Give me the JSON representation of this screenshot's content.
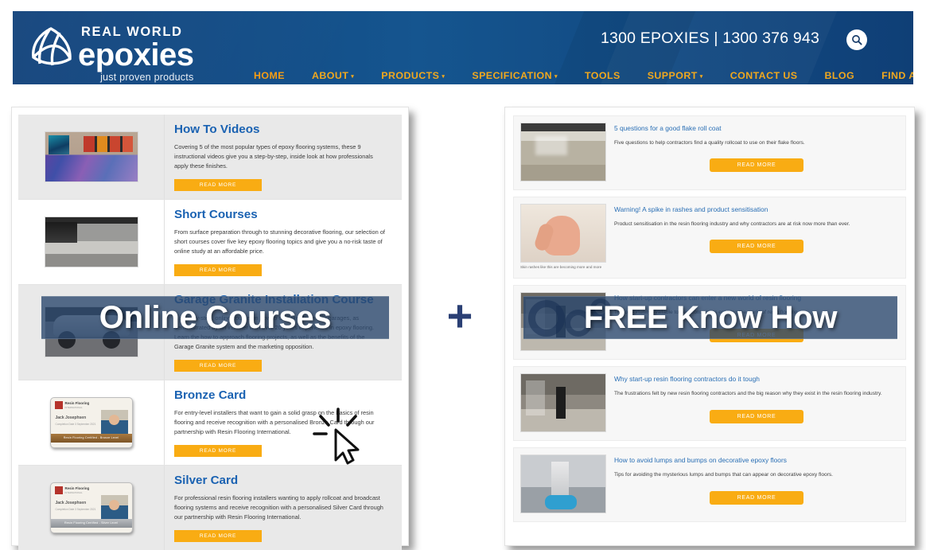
{
  "header": {
    "logo": {
      "line1": "REAL WORLD",
      "line2": "epoxies",
      "tagline": "just proven products",
      "mark": "epoxies-globe-logo"
    },
    "phone": "1300 EPOXIES | 1300 376 943",
    "search_icon": "search-icon",
    "nav": [
      {
        "label": "HOME",
        "caret": "",
        "active": true
      },
      {
        "label": "ABOUT",
        "caret": "▾",
        "active": false
      },
      {
        "label": "PRODUCTS",
        "caret": "▾",
        "active": false
      },
      {
        "label": "SPECIFICATION",
        "caret": "▾",
        "active": false
      },
      {
        "label": "TOOLS",
        "caret": "",
        "active": false
      },
      {
        "label": "SUPPORT",
        "caret": "▾",
        "active": false
      },
      {
        "label": "CONTACT US",
        "caret": "",
        "active": false
      },
      {
        "label": "BLOG",
        "caret": "",
        "active": false
      },
      {
        "label": "FIND AN INSTALLER",
        "caret": "",
        "active": false
      }
    ],
    "colors": {
      "bar": "#12457f",
      "nav_link": "#f0a81e"
    }
  },
  "overlays": {
    "left_banner": "Online Courses",
    "right_banner": "FREE Know How",
    "plus": "+",
    "cursor_icon": "click-cursor-icon"
  },
  "left_panel": {
    "name": "online-courses-panel",
    "rows": [
      {
        "title": "How To Videos",
        "desc": "Covering 5 of the most popular types of epoxy flooring systems, these 9 instructional videos give you a step-by-step, inside look at how professionals apply these finishes.",
        "button": "READ MORE",
        "thumb": "gallery-floor-photo"
      },
      {
        "title": "Short Courses",
        "desc": "From surface preparation through to stunning decorative flooring, our selection of short courses cover five key epoxy flooring topics and give you a no-risk taste of online study at an affordable price.",
        "button": "READ MORE",
        "thumb": "warehouse-floor-photo"
      },
      {
        "title": "Garage Granite Installation Course",
        "desc": "A step-by-step, online course on how to do flake flooring in garages, as demonstrated by an installer with over 20 years experience in epoxy flooring. Learn the how to approach flooring projects, as well as the benefits of the Garage Granite system and the marketing opposition.",
        "button": "READ MORE",
        "thumb": "garage-car-photo"
      },
      {
        "title": "Bronze Card",
        "desc": "For entry-level installers that want to gain a solid grasp on the basics of resin flooring and receive recognition with a personalised Bronze Card through our partnership with Resin Flooring International.",
        "button": "READ MORE",
        "thumb": "bronze-id-card"
      },
      {
        "title": "Silver Card",
        "desc": "For professional resin flooring installers wanting to apply rollcoat and broadcast flooring systems and receive recognition with a personalised Silver Card through our partnership with Resin Flooring International.",
        "button": "READ MORE",
        "thumb": "silver-id-card"
      }
    ],
    "id_card": {
      "brand": "Resin Flooring",
      "brand_sub": "INTERNATIONAL",
      "name": "Jack Josephsen",
      "meta": "Completion Date\n3 September 2021",
      "bronze_band": "Resin Flooring Certified - Bronze Level",
      "silver_band": "Resin Flooring Certified - Silver Level"
    }
  },
  "right_panel": {
    "name": "free-know-how-panel",
    "rows": [
      {
        "title": "5 questions for a good flake roll coat",
        "desc": "Five questions to help contractors find a quality rollcoat to use on their flake floors.",
        "button": "READ MORE",
        "thumb": "wet-flake-floor-photo",
        "caption": ""
      },
      {
        "title": "Warning! A spike in rashes and product sensitisation",
        "desc": "Product sensitisation in the resin flooring industry and why contractors are at risk now more than ever.",
        "button": "READ MORE",
        "thumb": "skin-rash-hand-photo",
        "caption": "Skin rashes like this are becoming more and more"
      },
      {
        "title": "How start-up contractors can enter a new world of resin flooring",
        "desc": "The opportunity available to new contractors entering the world of resin flooring.",
        "button": "READ MORE",
        "thumb": "contractor-photo",
        "caption": ""
      },
      {
        "title": "Why start-up resin flooring contractors do it tough",
        "desc": "The frustrations felt by new resin flooring contractors and the big reason why they exist in the resin flooring industry.",
        "button": "READ MORE",
        "thumb": "installer-squeegee-photo",
        "caption": ""
      },
      {
        "title": "How to avoid lumps and bumps on decorative epoxy floors",
        "desc": "Tips for avoiding the mysterious lumps and bumps that can appear on decorative epoxy floors.",
        "button": "READ MORE",
        "thumb": "epoxy-bumps-photo",
        "caption": ""
      }
    ]
  }
}
